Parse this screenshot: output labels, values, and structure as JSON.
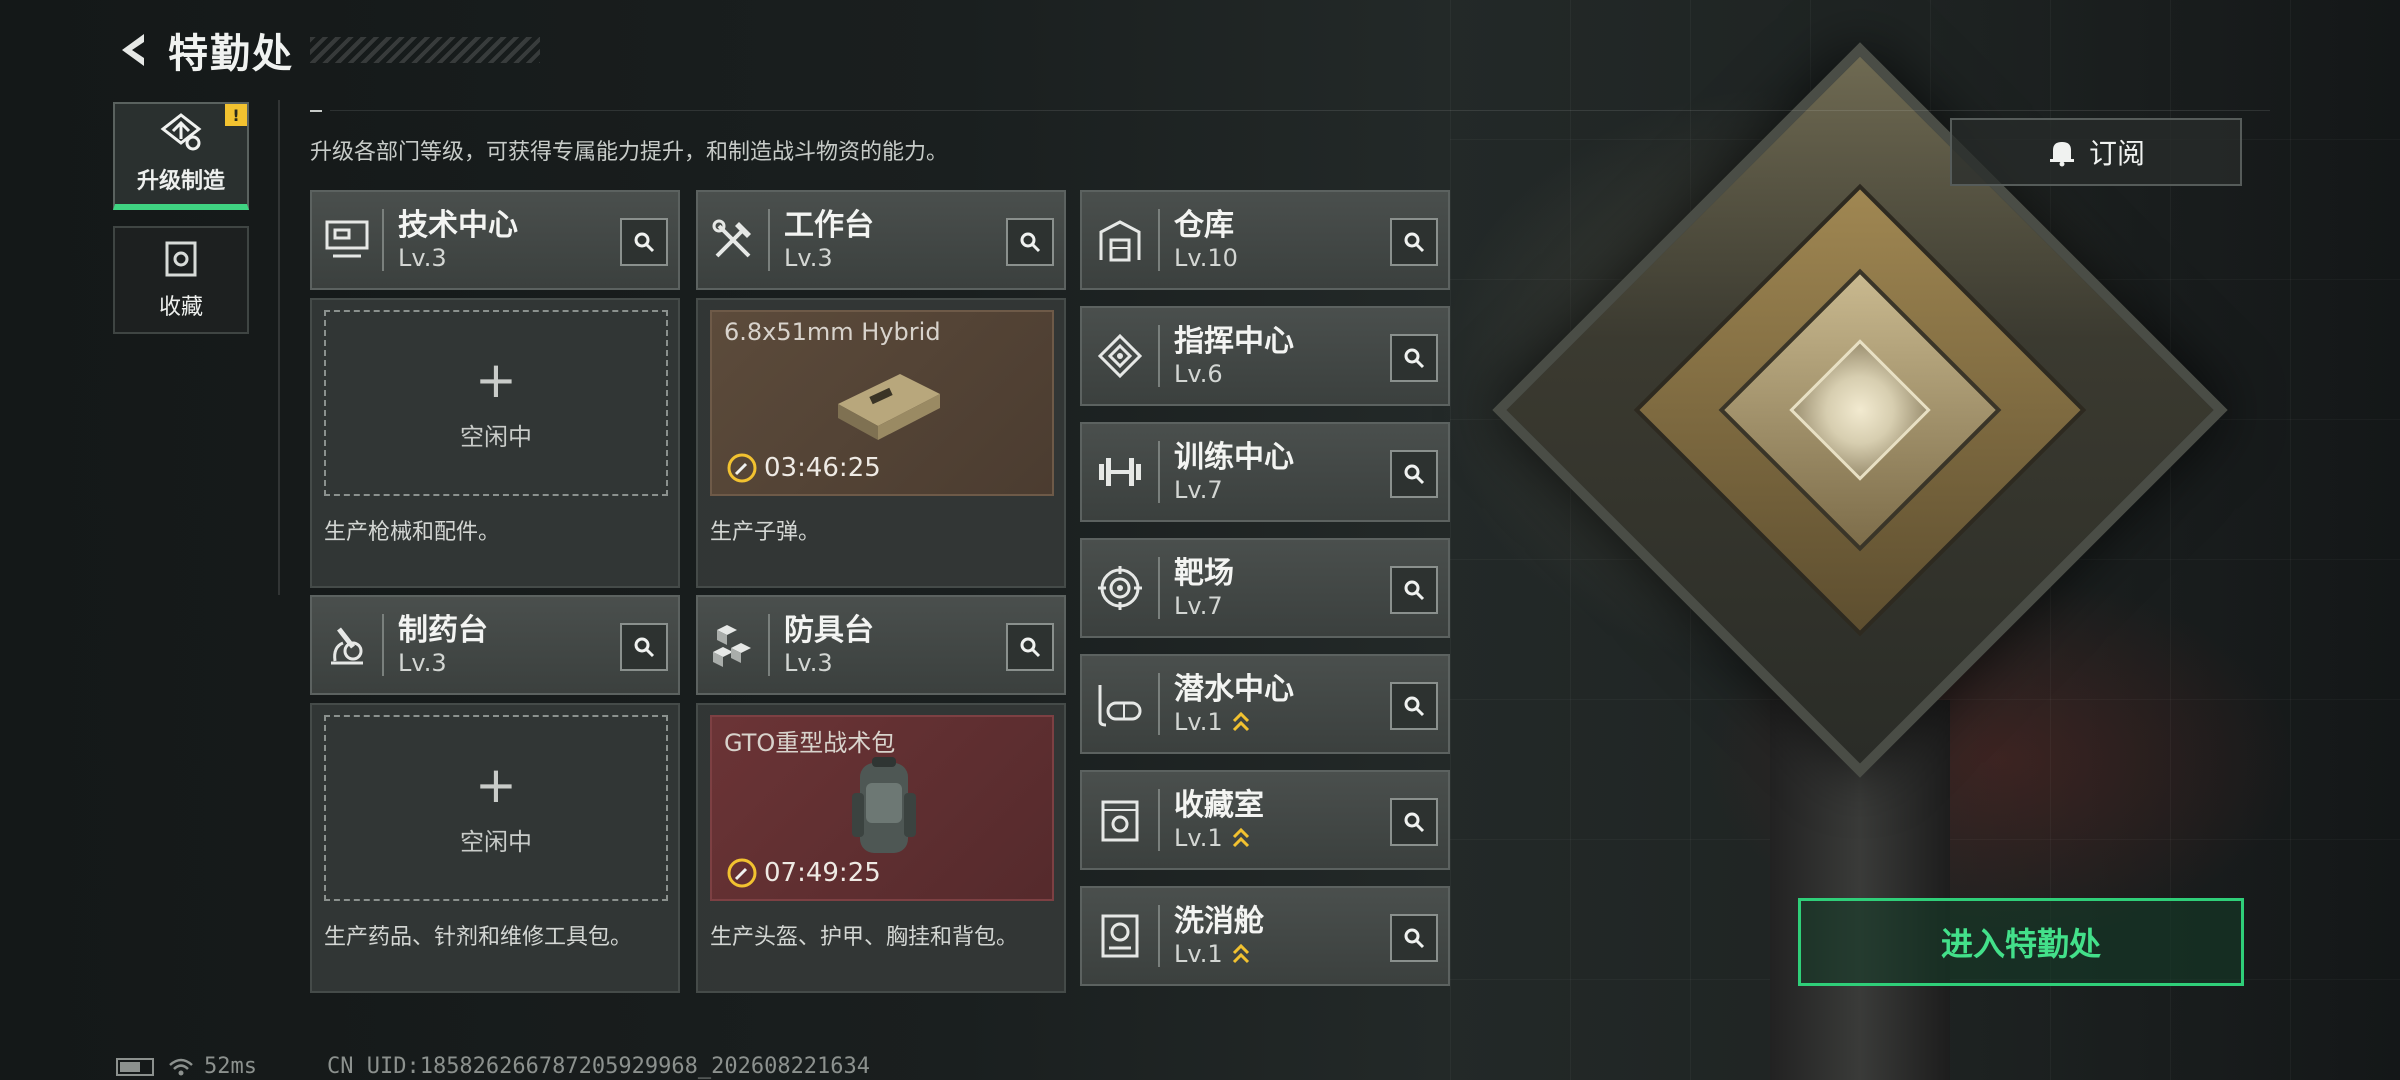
{
  "header": {
    "title": "特勤处"
  },
  "tabs": [
    {
      "label": "升级制造",
      "active": true,
      "badge": "!"
    },
    {
      "label": "收藏",
      "active": false
    }
  ],
  "description": "升级各部门等级，可获得专属能力提升，和制造战斗物资的能力。",
  "stations": {
    "tech": {
      "name": "技术中心",
      "level": "Lv.3",
      "slot": {
        "plus": "+",
        "status": "空闲中"
      },
      "subtext": "生产枪械和配件。"
    },
    "workbench": {
      "name": "工作台",
      "level": "Lv.3",
      "production": {
        "item": "6.8x51mm Hybrid",
        "timer": "03:46:25"
      },
      "subtext": "生产子弹。"
    },
    "pharmacy": {
      "name": "制药台",
      "level": "Lv.3",
      "slot": {
        "plus": "+",
        "status": "空闲中"
      },
      "subtext": "生产药品、针剂和维修工具包。"
    },
    "armor": {
      "name": "防具台",
      "level": "Lv.3",
      "production": {
        "item": "GTO重型战术包",
        "timer": "07:49:25"
      },
      "subtext": "生产头盔、护甲、胸挂和背包。"
    }
  },
  "facilities": [
    {
      "name": "仓库",
      "level": "Lv.10",
      "upgradable": false,
      "icon": "warehouse-icon"
    },
    {
      "name": "指挥中心",
      "level": "Lv.6",
      "upgradable": false,
      "icon": "command-icon"
    },
    {
      "name": "训练中心",
      "level": "Lv.7",
      "upgradable": false,
      "icon": "dumbbell-icon"
    },
    {
      "name": "靶场",
      "level": "Lv.7",
      "upgradable": false,
      "icon": "target-icon"
    },
    {
      "name": "潜水中心",
      "level": "Lv.1",
      "upgradable": true,
      "icon": "diving-mask-icon"
    },
    {
      "name": "收藏室",
      "level": "Lv.1",
      "upgradable": true,
      "icon": "collection-icon"
    },
    {
      "name": "洗消舱",
      "level": "Lv.1",
      "upgradable": true,
      "icon": "decontamination-icon"
    }
  ],
  "subscribe": {
    "label": "订阅"
  },
  "enter_button": {
    "label": "进入特勤处"
  },
  "footer": {
    "ping": "52ms",
    "uid": "CN UID:1858262667872059299​68_202608221634"
  },
  "colors": {
    "accent": "#3fd482",
    "upgrade_arrow": "#f2c230"
  }
}
